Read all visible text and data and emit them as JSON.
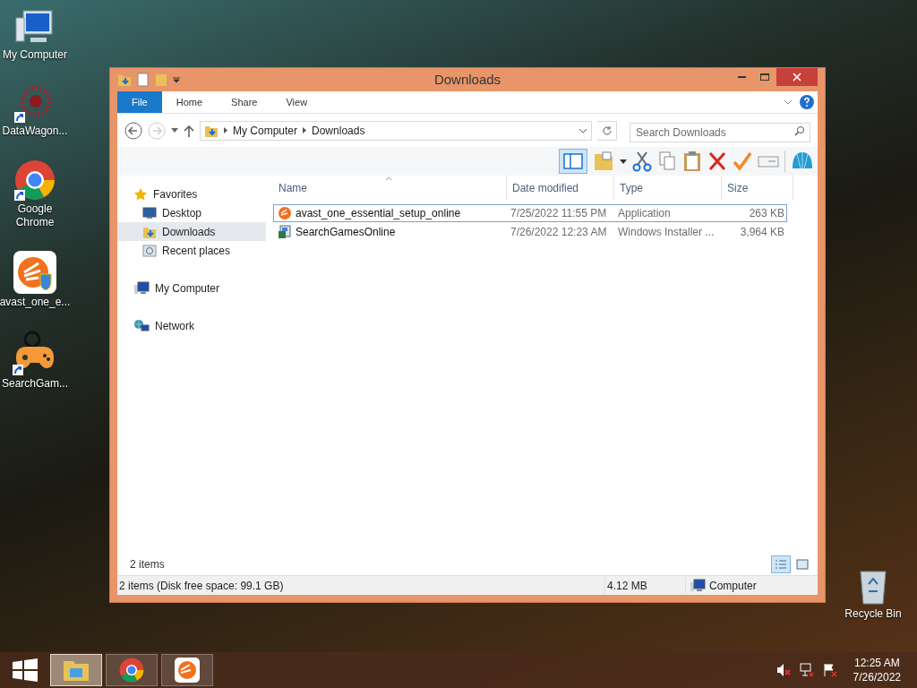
{
  "desktop_icons": [
    {
      "kind": "computer",
      "label": "My Computer",
      "shortcut": false
    },
    {
      "kind": "burst",
      "label": "DataWagon...",
      "shortcut": true
    },
    {
      "kind": "chrome",
      "label": "Google Chrome",
      "shortcut": true
    },
    {
      "kind": "avast",
      "label": "avast_one_e...",
      "shortcut": false
    },
    {
      "kind": "gamepad",
      "label": "SearchGam...",
      "shortcut": true
    }
  ],
  "recycle_bin": {
    "label": "Recycle Bin"
  },
  "window": {
    "title": "Downloads",
    "ribbon_tabs": [
      {
        "label": "File",
        "selected": true
      },
      {
        "label": "Home",
        "selected": false
      },
      {
        "label": "Share",
        "selected": false
      },
      {
        "label": "View",
        "selected": false
      }
    ],
    "address": {
      "crumbs": [
        "My Computer",
        "Downloads"
      ]
    },
    "search": {
      "placeholder": "Search Downloads"
    },
    "nav": [
      {
        "label": "Favorites",
        "kind": "star",
        "selected": false,
        "children": [
          {
            "label": "Desktop",
            "kind": "desktop",
            "selected": false
          },
          {
            "label": "Downloads",
            "kind": "downloads",
            "selected": true
          },
          {
            "label": "Recent places",
            "kind": "recent",
            "selected": false
          }
        ]
      },
      {
        "label": "My Computer",
        "kind": "computer",
        "selected": false
      },
      {
        "label": "Network",
        "kind": "network",
        "selected": false
      }
    ],
    "columns": [
      "Name",
      "Date modified",
      "Type",
      "Size"
    ],
    "rows": [
      {
        "kind": "avast",
        "name": "avast_one_essential_setup_online",
        "date": "7/25/2022 11:55 PM",
        "type": "Application",
        "size": "263 KB",
        "selected": true
      },
      {
        "kind": "installer",
        "name": "SearchGamesOnline",
        "date": "7/26/2022 12:23 AM",
        "type": "Windows Installer ...",
        "size": "3,964 KB",
        "selected": false
      }
    ],
    "item_count": "2 items",
    "view_buttons": [
      {
        "kind": "details",
        "selected": true
      },
      {
        "kind": "tiles",
        "selected": false
      }
    ],
    "status": {
      "items": "2 items (Disk free space: 99.1 GB)",
      "size": "4.12 MB",
      "location": "Computer"
    }
  },
  "taskbar": {
    "apps": [
      {
        "kind": "explorer",
        "selected": true
      },
      {
        "kind": "chrome",
        "selected": false
      },
      {
        "kind": "avast",
        "selected": false
      }
    ],
    "time": "12:25 AM",
    "date": "7/26/2022"
  }
}
